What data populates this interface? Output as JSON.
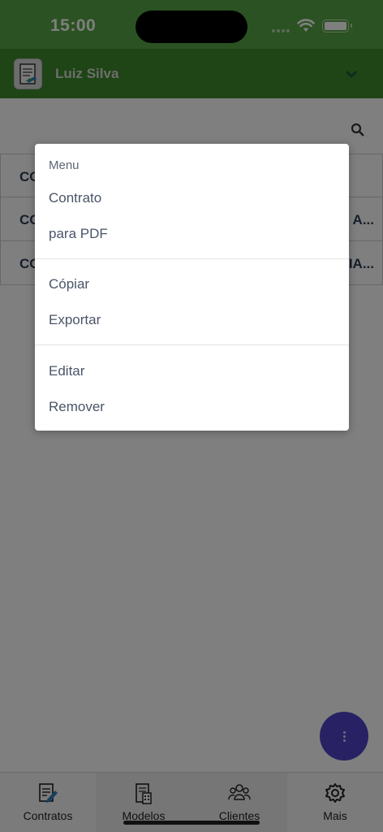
{
  "status_bar": {
    "time": "15:00"
  },
  "header": {
    "user_name": "Luiz Silva"
  },
  "list": {
    "items": [
      {
        "code": "CO",
        "trail": ""
      },
      {
        "code": "CO",
        "trail": "A..."
      },
      {
        "code": "CO",
        "trail": "IA..."
      }
    ]
  },
  "menu": {
    "header": "Menu",
    "items": [
      {
        "label": "Contrato"
      },
      {
        "label": "para PDF"
      },
      {
        "label": "Cópiar"
      },
      {
        "label": "Exportar"
      },
      {
        "label": "Editar"
      },
      {
        "label": "Remover"
      }
    ]
  },
  "tab_bar": {
    "tabs": [
      {
        "label": "Contratos",
        "icon": "contract-edit-icon"
      },
      {
        "label": "Modelos",
        "icon": "document-building-icon"
      },
      {
        "label": "Clientes",
        "icon": "users-group-icon"
      },
      {
        "label": "Mais",
        "icon": "gear-icon"
      }
    ]
  },
  "colors": {
    "status_bar": "#57a545",
    "header": "#3e8a2f",
    "fab": "#5145c8",
    "text_dark": "#2d3e56"
  }
}
